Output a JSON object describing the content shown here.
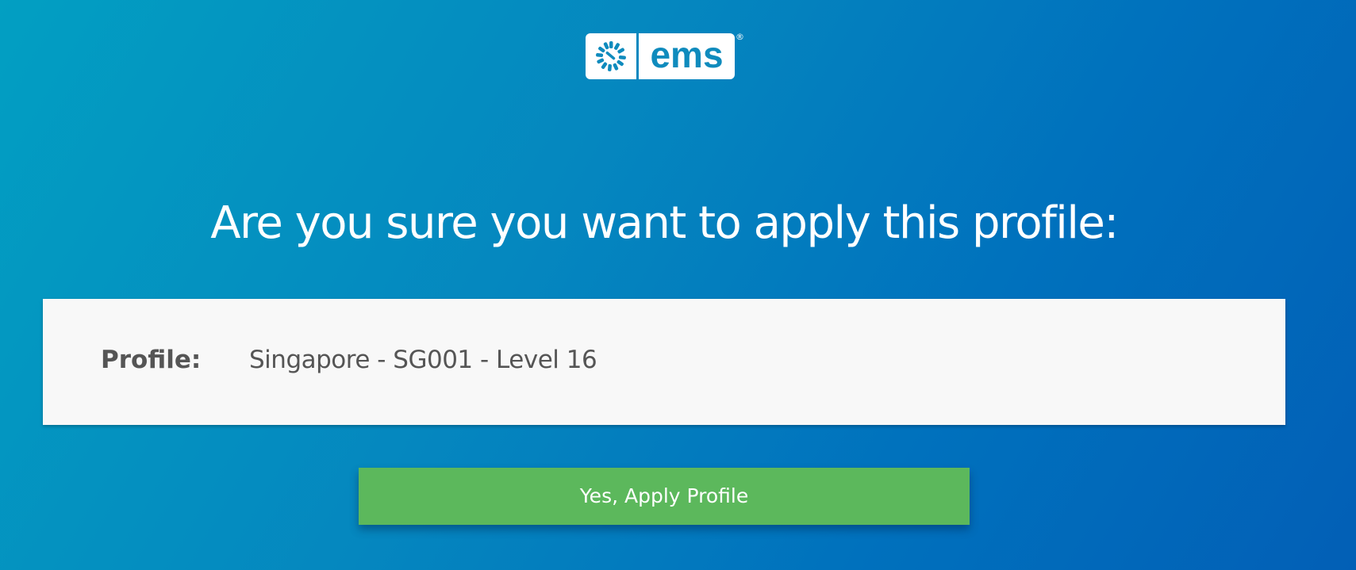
{
  "logo": {
    "wordmark": "ems",
    "registered": "®",
    "brand_color": "#0f8bbd"
  },
  "dialog": {
    "heading": "Are you sure you want to apply this profile:",
    "profile_label": "Profile:",
    "profile_value": "Singapore - SG001 - Level 16",
    "confirm_button": "Yes, Apply Profile"
  },
  "colors": {
    "background_start": "#029fc2",
    "background_end": "#025fb6",
    "card_background": "#f8f8f8",
    "button_green": "#5cb85c",
    "label_text": "#555555"
  },
  "icons": {
    "logo_mark": "sunburst-logo-icon"
  }
}
